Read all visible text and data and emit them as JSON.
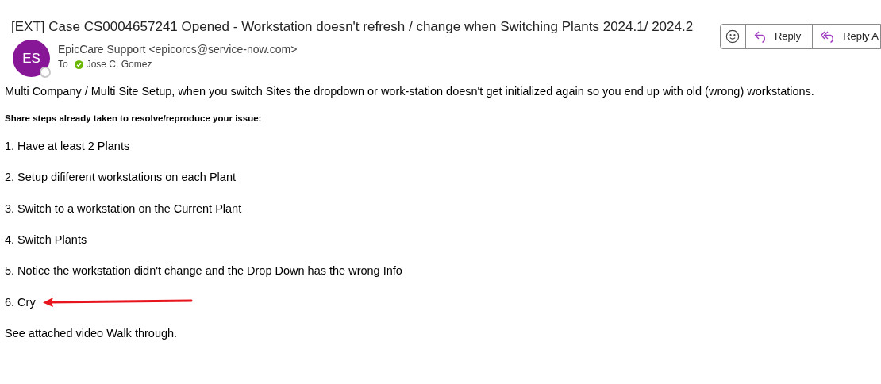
{
  "subject": "[EXT] Case CS0004657241 Opened - Workstation doesn't refresh / change when Switching Plants 2024.1/ 2024.2",
  "sender": {
    "initials": "ES",
    "name": "EpicCare Support <epicorcs@service-now.com>",
    "to_label": "To",
    "recipient": "Jose C. Gomez"
  },
  "actions": [
    "Reply",
    "Reply A"
  ],
  "body": {
    "intro": "Multi Company / Multi Site Setup, when you switch Sites the dropdown or work-station doesn't get initialized again so you end up with old (wrong) workstations.",
    "heading": "Share steps already taken to resolve/reproduce your issue:",
    "steps": [
      {
        "text": "1. Have at least 2 Plants",
        "annotated": false
      },
      {
        "text": "2. Setup dififerent workstations on each Plant",
        "annotated": false
      },
      {
        "text": "3. Switch to a workstation on the Current Plant",
        "annotated": false
      },
      {
        "text": "4. Switch Plants",
        "annotated": false
      },
      {
        "text": "5. Notice the workstation didn't change and the Drop Down has the wrong Info",
        "annotated": false
      },
      {
        "text": "6. Cry",
        "annotated": true
      }
    ],
    "closing": "See attached video Walk through."
  }
}
